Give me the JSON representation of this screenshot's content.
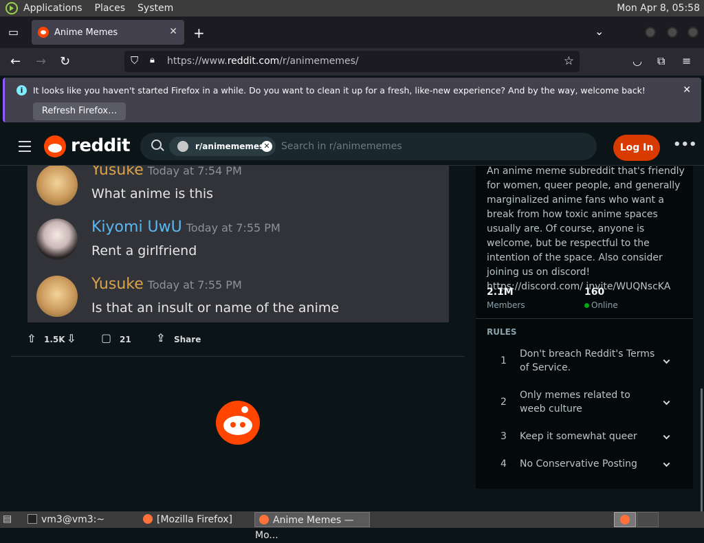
{
  "panel": {
    "menu": [
      "Applications",
      "Places",
      "System"
    ],
    "clock": "Mon Apr  8, 05:58"
  },
  "browser": {
    "tab_title": "Anime Memes",
    "url_prefix": "https://www.",
    "url_domain": "reddit.com",
    "url_path": "/r/animememes/"
  },
  "notification": {
    "message": "It looks like you haven't started Firefox in a while. Do you want to clean it up for a fresh, like-new experience? And by the way, welcome back!",
    "button": "Refresh Firefox…"
  },
  "reddit": {
    "wordmark": "reddit",
    "search_chip": "r/animememes",
    "search_placeholder": "Search in r/animememes",
    "login": "Log In"
  },
  "post": {
    "messages": [
      {
        "user": "Yusuke",
        "time": "Today at 7:54 PM",
        "text": "What anime is this",
        "color": "#d9a34a"
      },
      {
        "user": "Kiyomi UwU",
        "time": "Today at 7:55 PM",
        "text": "Rent a girlfriend",
        "color": "#5ab7f2"
      },
      {
        "user": "Yusuke",
        "time": "Today at 7:55 PM",
        "text": "Is that an insult or name of the anime",
        "color": "#d9a34a"
      }
    ],
    "votes": "1.5K",
    "comments": "21",
    "share": "Share"
  },
  "sidebar": {
    "description": "An anime meme subreddit that's friendly for women, queer people, and generally marginalized anime fans who want a break from how toxic anime spaces usually are. Of course, anyone is welcome, but be respectful to the intention of the space. Also consider joining us on discord! https://discord.com/ invite/WUQNscKA",
    "members_value": "2.1M",
    "members_label": "Members",
    "online_value": "160",
    "online_label": "Online",
    "rules_heading": "RULES",
    "rules": [
      {
        "num": "1",
        "text": "Don't breach Reddit's Terms of Service."
      },
      {
        "num": "2",
        "text": "Only memes related to weeb culture"
      },
      {
        "num": "3",
        "text": "Keep it somewhat queer"
      },
      {
        "num": "4",
        "text": "No Conservative Posting"
      }
    ]
  },
  "taskbar": {
    "items": [
      "vm3@vm3:~",
      "[Mozilla Firefox]",
      "Anime Memes — Mo..."
    ]
  },
  "colors": {
    "reddit_orange": "#ff4500",
    "login_button": "#d93a00",
    "online_dot": "#01a816"
  }
}
